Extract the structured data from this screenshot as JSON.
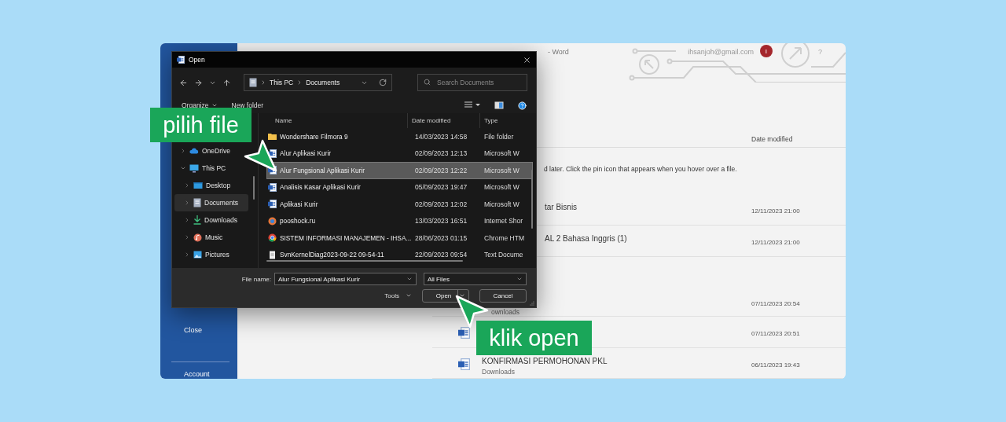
{
  "word": {
    "title": "- Word",
    "account_email": "ihsanjoh@gmail.com",
    "avatar_initial": "I",
    "help": "?",
    "sidebar": [
      {
        "label": "Close"
      },
      {
        "label": "Account"
      }
    ],
    "list_header": "Date modified",
    "pin_hint": "d later. Click the pin icon that appears when you hover over a file.",
    "groups": [
      {
        "rows": [
          {
            "title": "tar Bisnis",
            "cut": true,
            "date": "12/11/2023 21:00"
          },
          {
            "title": "AL 2 Bahasa Inggris (1)",
            "cut": true,
            "date": "12/11/2023 21:00"
          }
        ]
      },
      {
        "rows": [
          {
            "subtitle": "ownloads",
            "cut": true,
            "date": "07/11/2023 20:54"
          },
          {
            "kind": "word",
            "date": "07/11/2023 20:51"
          },
          {
            "kind": "word",
            "title": "KONFIRMASI PERMOHONAN PKL",
            "subtitle": "Downloads",
            "date": "06/11/2023 19:43"
          }
        ]
      }
    ]
  },
  "dialog": {
    "title": "Open",
    "path": [
      "This PC",
      "Documents"
    ],
    "search": {
      "placeholder": "Search Documents"
    },
    "toolbar": {
      "organize": "Organize",
      "new_folder": "New folder"
    },
    "nav": [
      {
        "label": "OneDrive",
        "kind": "cloud",
        "expanded": false,
        "selected": false
      },
      {
        "label": "This PC",
        "kind": "pc",
        "expanded": true,
        "selected": false,
        "children": [
          {
            "label": "Desktop",
            "kind": "desktop",
            "expanded": false,
            "selected": false
          },
          {
            "label": "Documents",
            "kind": "documents",
            "expanded": false,
            "selected": true
          },
          {
            "label": "Downloads",
            "kind": "download",
            "expanded": false,
            "selected": false
          },
          {
            "label": "Music",
            "kind": "music",
            "expanded": false,
            "selected": false
          },
          {
            "label": "Pictures",
            "kind": "pictures",
            "expanded": false,
            "selected": false
          }
        ]
      }
    ],
    "columns": [
      "Name",
      "Date modified",
      "Type"
    ],
    "files": [
      {
        "name": "Wondershare Filmora 9",
        "kind": "folder",
        "date": "14/03/2023 14:58",
        "type": "File folder",
        "selected": false
      },
      {
        "name": "Alur Aplikasi Kurir",
        "kind": "word",
        "date": "02/09/2023 12:13",
        "type": "Microsoft W",
        "selected": false
      },
      {
        "name": "Alur Fungsional Aplikasi Kurir",
        "kind": "word",
        "date": "02/09/2023 12:22",
        "type": "Microsoft W",
        "selected": true
      },
      {
        "name": "Analisis Kasar Aplikasi Kurir",
        "kind": "word",
        "date": "05/09/2023 19:47",
        "type": "Microsoft W",
        "selected": false
      },
      {
        "name": "Aplikasi Kurir",
        "kind": "word",
        "date": "02/09/2023 12:02",
        "type": "Microsoft W",
        "selected": false
      },
      {
        "name": "pooshock.ru",
        "kind": "url",
        "date": "13/03/2023 16:51",
        "type": "Internet Shor",
        "selected": false
      },
      {
        "name": "SISTEM INFORMASI MANAJEMEN - IHSA...",
        "kind": "chrome",
        "date": "28/06/2023 01:15",
        "type": "Chrome HTM",
        "selected": false
      },
      {
        "name": "SvnKernelDiag2023-09-22 09-54-11",
        "kind": "text",
        "date": "22/09/2023 09:54",
        "type": "Text Docume",
        "selected": false
      }
    ],
    "file_name_label": "File name:",
    "file_name": "Alur Fungsional Aplikasi Kurir",
    "filter": "All Files",
    "tools": "Tools",
    "open": "Open",
    "cancel": "Cancel"
  },
  "callouts": [
    {
      "text": "pilih file"
    },
    {
      "text": "klik open"
    }
  ]
}
